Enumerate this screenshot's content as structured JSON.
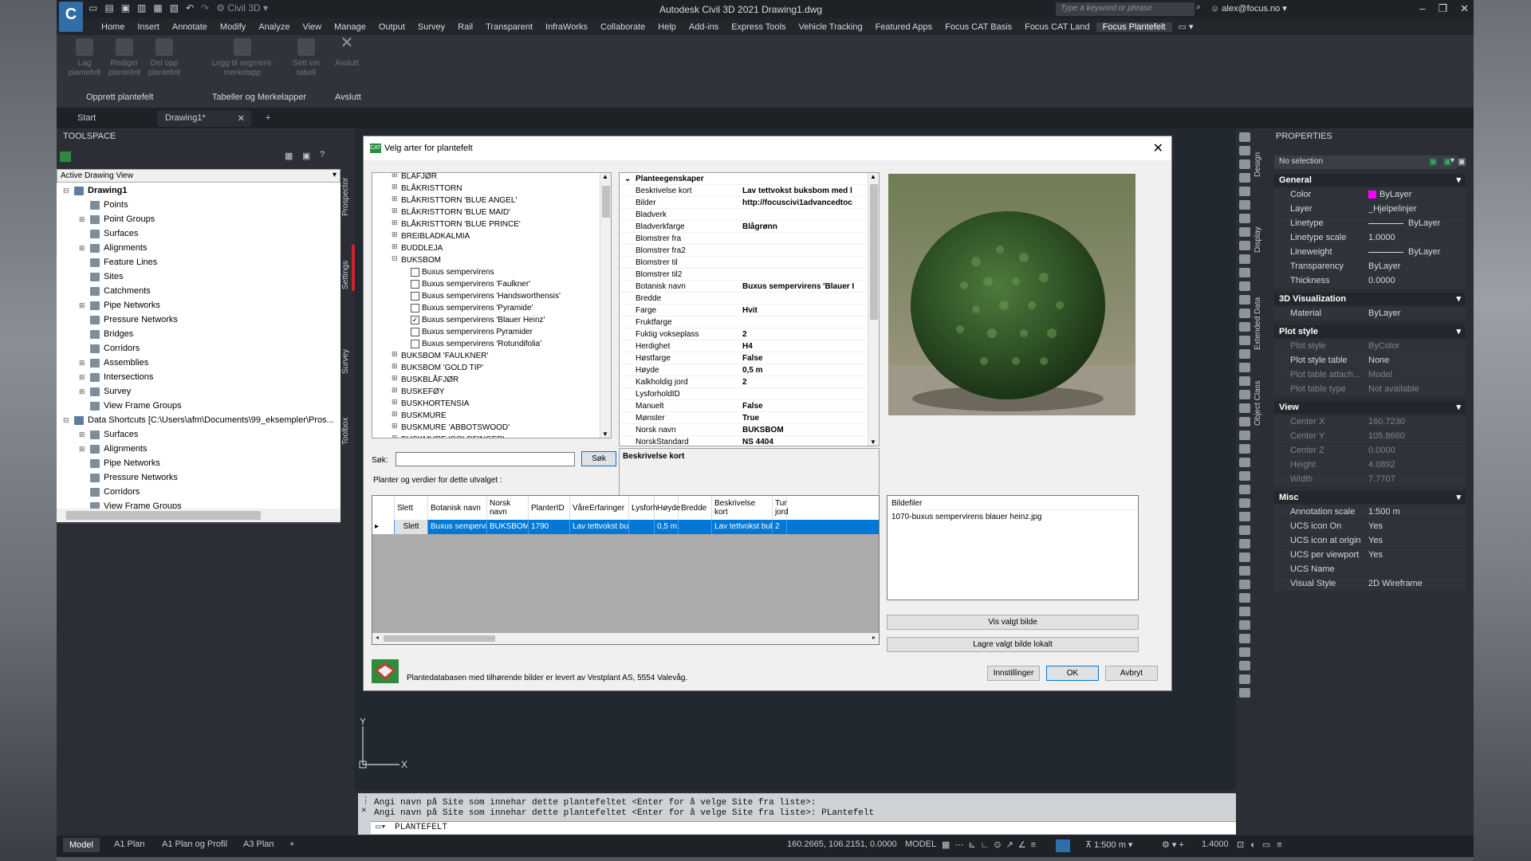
{
  "app": {
    "title": "Autodesk Civil 3D 2021   Drawing1.dwg",
    "workspace": "Civil 3D",
    "search_placeholder": "Type a keyword or phrase",
    "user": "alex@focus.no"
  },
  "menu": [
    "Home",
    "Insert",
    "Annotate",
    "Modify",
    "Analyze",
    "View",
    "Manage",
    "Output",
    "Survey",
    "Rail",
    "Transparent",
    "InfraWorks",
    "Collaborate",
    "Help",
    "Add-ins",
    "Express Tools",
    "Vehicle Tracking",
    "Featured Apps",
    "Focus CAT Basis",
    "Focus CAT Land",
    "Focus Plantefelt"
  ],
  "ribbon": {
    "buttons": [
      "Lag plantefelt",
      "Rediger plantefelt",
      "Del opp plantefelt",
      "Legg til segment-merkelapp",
      "Sett inn tabell",
      "Avslutt"
    ],
    "groups": [
      "Opprett plantefelt",
      "Tabeller og Merkelapper",
      "Avslutt"
    ]
  },
  "doctabs": [
    "Start",
    "Drawing1*"
  ],
  "toolspace": {
    "title": "TOOLSPACE",
    "view": "Active Drawing View",
    "tree": [
      "Drawing1",
      "Points",
      "Point Groups",
      "Surfaces",
      "Alignments",
      "Feature Lines",
      "Sites",
      "Catchments",
      "Pipe Networks",
      "Pressure Networks",
      "Bridges",
      "Corridors",
      "Assemblies",
      "Intersections",
      "Survey",
      "View Frame Groups",
      "Data Shortcuts [C:\\Users\\afm\\Documents\\99_eksempler\\Pros...",
      "Surfaces",
      "Alignments",
      "Pipe Networks",
      "Pressure Networks",
      "Corridors",
      "View Frame Groups"
    ],
    "vtabs": [
      "Prospector",
      "Settings",
      "Survey",
      "Toolbox"
    ]
  },
  "dialog": {
    "title": "Velg arter for plantefelt",
    "species": [
      "BLÅFJØR",
      "BLÅKRISTTORN",
      "BLÅKRISTTORN 'BLUE ANGEL'",
      "BLÅKRISTTORN 'BLUE MAID'",
      "BLÅKRISTTORN 'BLUE PRINCE'",
      "BREIBLADKALMIA",
      "BUDDLEJA",
      "BUKSBOM",
      "Buxus sempervirens",
      "Buxus sempervirens  'Faulkner'",
      "Buxus sempervirens  'Handsworthensis'",
      "Buxus sempervirens  'Pyramide'",
      "Buxus sempervirens 'Blauer Heinz'",
      "Buxus sempervirens Pyramider",
      "Buxus sempervirens 'Rotundifolia'",
      "BUKSBOM 'FAULKNER'",
      "BUKSBOM 'GOLD TIP'",
      "BUSKBLÅFJØR",
      "BUSKEFØY",
      "BUSKHORTENSIA",
      "BUSKMURE",
      "BUSKMURE 'ABBOTSWOOD'",
      "BUSKMURE 'GOLDFINGER'"
    ],
    "properties_header": "Planteegenskaper",
    "properties": [
      {
        "k": "Beskrivelse kort",
        "v": "Lav tettvokst buksbom med l"
      },
      {
        "k": "Bilder",
        "v": "http://focuscivi1advancedtoc"
      },
      {
        "k": "Bladverk",
        "v": ""
      },
      {
        "k": "Bladverkfarge",
        "v": "Blågrønn"
      },
      {
        "k": "Blomstrer fra",
        "v": ""
      },
      {
        "k": "Blomstrer fra2",
        "v": ""
      },
      {
        "k": "Blomstrer til",
        "v": ""
      },
      {
        "k": "Blomstrer til2",
        "v": ""
      },
      {
        "k": "Botanisk navn",
        "v": "Buxus sempervirens 'Blauer I"
      },
      {
        "k": "Bredde",
        "v": ""
      },
      {
        "k": "Farge",
        "v": "Hvit"
      },
      {
        "k": "Fruktfarge",
        "v": ""
      },
      {
        "k": "Fuktig vokseplass",
        "v": "2"
      },
      {
        "k": "Herdighet",
        "v": "H4"
      },
      {
        "k": "Høstfarge",
        "v": "False"
      },
      {
        "k": "Høyde",
        "v": "0,5 m"
      },
      {
        "k": "Kalkholdig jord",
        "v": "2"
      },
      {
        "k": "LysforholdID",
        "v": ""
      },
      {
        "k": "Manuelt",
        "v": "False"
      },
      {
        "k": "Mønster",
        "v": "True"
      },
      {
        "k": "Norsk navn",
        "v": "BUKSBOM"
      },
      {
        "k": "NorskStandard",
        "v": "NS 4404"
      }
    ],
    "description_label": "Beskrivelse kort",
    "search_label": "Søk:",
    "search_button": "Søk",
    "selection_label": "Planter og verdier for dette utvalget :",
    "table_headers": [
      "Slett",
      "Botanisk navn",
      "Norsk navn",
      "PlanterID",
      "VåreErfaringer",
      "Lysforh",
      "Høyde",
      "Bredde",
      "Beskrivelse kort",
      "Tur jord"
    ],
    "table_row": [
      "Slett",
      "Buxus sempervire...",
      "BUKSBOM",
      "1790",
      "Lav tettvokst buk...",
      "",
      "0,5 m",
      "",
      "Lav tettvokst buk...",
      "2"
    ],
    "imagefiles_label": "Bildefiler",
    "imagefile": "1070-buxus sempervirens blauer heinz.jpg",
    "btn_show": "Vis valgt bilde",
    "btn_save": "Lagre valgt bilde lokalt",
    "footer": "Plantedatabasen med tilhørende bilder er levert av Vestplant AS, 5554 Valevåg.",
    "btn_settings": "Innstillinger",
    "btn_ok": "OK",
    "btn_cancel": "Avbryt"
  },
  "command": {
    "line1": "Angi navn på Site som innehar dette plantefeltet <Enter for å velge Site fra liste>:",
    "line2": "Angi navn på Site som innehar dette plantefeltet <Enter for å velge Site fra liste>: PLantefelt",
    "input": "PLANTEFELT"
  },
  "layouts": [
    "Model",
    "A1 Plan",
    "A1 Plan og Profil",
    "A3 Plan"
  ],
  "status": {
    "coords": "160.2665, 106.2151, 0.0000",
    "mode": "MODEL",
    "scale": "1:500",
    "zoom": "1.4000"
  },
  "properties": {
    "title": "PROPERTIES",
    "selection": "No selection",
    "sections": [
      {
        "name": "General",
        "rows": [
          [
            "Color",
            "ByLayer"
          ],
          [
            "Layer",
            "_Hjelpelinjer"
          ],
          [
            "Linetype",
            "ByLayer"
          ],
          [
            "Linetype scale",
            "1.0000"
          ],
          [
            "Lineweight",
            "ByLayer"
          ],
          [
            "Transparency",
            "ByLayer"
          ],
          [
            "Thickness",
            "0.0000"
          ]
        ]
      },
      {
        "name": "3D Visualization",
        "rows": [
          [
            "Material",
            "ByLayer"
          ]
        ]
      },
      {
        "name": "Plot style",
        "rows": [
          [
            "Plot style",
            "ByColor"
          ],
          [
            "Plot style table",
            "None"
          ],
          [
            "Plot table attach...",
            "Model"
          ],
          [
            "Plot table type",
            "Not available"
          ]
        ]
      },
      {
        "name": "View",
        "rows": [
          [
            "Center X",
            "160.7230"
          ],
          [
            "Center Y",
            "105.8660"
          ],
          [
            "Center Z",
            "0.0000"
          ],
          [
            "Height",
            "4.0892"
          ],
          [
            "Width",
            "7.7707"
          ]
        ]
      },
      {
        "name": "Misc",
        "rows": [
          [
            "Annotation scale",
            "1:500 m"
          ],
          [
            "UCS icon On",
            "Yes"
          ],
          [
            "UCS icon at origin",
            "Yes"
          ],
          [
            "UCS per viewport",
            "Yes"
          ],
          [
            "UCS Name",
            ""
          ],
          [
            "Visual Style",
            "2D Wireframe"
          ]
        ]
      }
    ],
    "vtabs": [
      "Design",
      "Display",
      "Extended Data",
      "Object Class"
    ]
  },
  "colors": {
    "accent": "#0078d7",
    "magenta": "#ff00ff",
    "red": "#c9252b"
  }
}
